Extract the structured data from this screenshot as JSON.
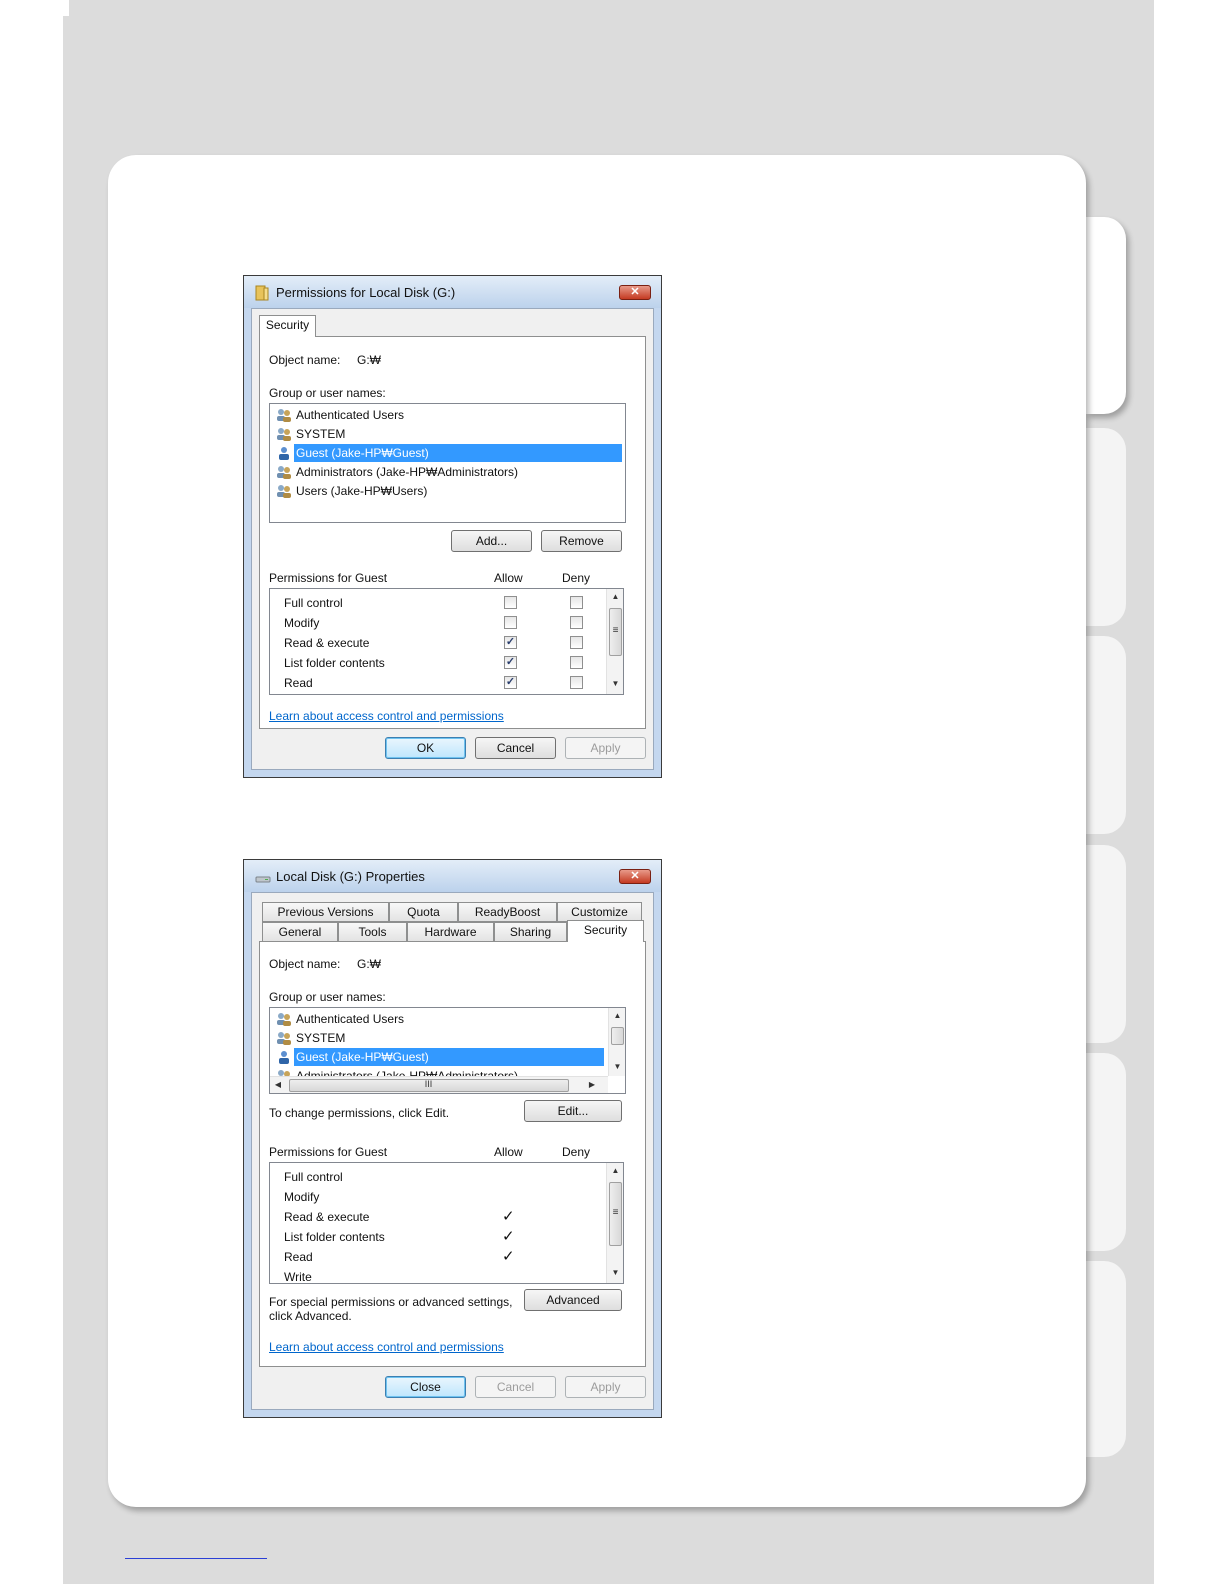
{
  "perm_window": {
    "title": "Permissions for Local Disk (G:)",
    "close_glyph": "✕",
    "tab": "Security",
    "object_label": "Object name:",
    "object_value": "G:₩",
    "group_label": "Group or user names:",
    "users": [
      {
        "name": "Authenticated Users",
        "icon": "users-group-icon",
        "selected": false
      },
      {
        "name": "SYSTEM",
        "icon": "users-group-icon",
        "selected": false
      },
      {
        "name": "Guest (Jake-HP₩Guest)",
        "icon": "user-icon",
        "selected": true
      },
      {
        "name": "Administrators (Jake-HP₩Administrators)",
        "icon": "users-group-icon",
        "selected": false
      },
      {
        "name": "Users (Jake-HP₩Users)",
        "icon": "users-group-icon",
        "selected": false
      }
    ],
    "add_button": "Add...",
    "remove_button": "Remove",
    "permissions_header": "Permissions for Guest",
    "allow_header": "Allow",
    "deny_header": "Deny",
    "permissions": [
      {
        "name": "Full control",
        "allow": false,
        "deny": false
      },
      {
        "name": "Modify",
        "allow": false,
        "deny": false
      },
      {
        "name": "Read & execute",
        "allow": true,
        "deny": false
      },
      {
        "name": "List folder contents",
        "allow": true,
        "deny": false
      },
      {
        "name": "Read",
        "allow": true,
        "deny": false
      }
    ],
    "learn_link": "Learn about access control and permissions",
    "ok_button": "OK",
    "cancel_button": "Cancel",
    "apply_button": "Apply"
  },
  "props_window": {
    "title": "Local Disk (G:) Properties",
    "close_glyph": "✕",
    "tabs_top": [
      "Previous Versions",
      "Quota",
      "ReadyBoost",
      "Customize"
    ],
    "tabs_bottom": [
      "General",
      "Tools",
      "Hardware",
      "Sharing",
      "Security"
    ],
    "selected_tab": "Security",
    "object_label": "Object name:",
    "object_value": "G:₩",
    "group_label": "Group or user names:",
    "users": [
      {
        "name": "Authenticated Users",
        "icon": "users-group-icon",
        "selected": false
      },
      {
        "name": "SYSTEM",
        "icon": "users-group-icon",
        "selected": false
      },
      {
        "name": "Guest (Jake-HP₩Guest)",
        "icon": "user-icon",
        "selected": true
      },
      {
        "name": "Administrators (Jake-HP₩Administrators)",
        "icon": "users-group-icon",
        "selected": false
      }
    ],
    "hscroll_grip": "III",
    "change_text": "To change permissions, click Edit.",
    "edit_button": "Edit...",
    "permissions_header": "Permissions for Guest",
    "allow_header": "Allow",
    "deny_header": "Deny",
    "permissions": [
      {
        "name": "Full control",
        "allow": false,
        "deny": false
      },
      {
        "name": "Modify",
        "allow": false,
        "deny": false
      },
      {
        "name": "Read & execute",
        "allow": true,
        "deny": false
      },
      {
        "name": "List folder contents",
        "allow": true,
        "deny": false
      },
      {
        "name": "Read",
        "allow": true,
        "deny": false
      },
      {
        "name": "Write",
        "allow": false,
        "deny": false
      }
    ],
    "tick_glyph": "✓",
    "special_text_line1": "For special permissions or advanced settings,",
    "special_text_line2": "click Advanced.",
    "advanced_button": "Advanced",
    "learn_link": "Learn about access control and permissions",
    "close_button": "Close",
    "cancel_button": "Cancel",
    "apply_button": "Apply"
  },
  "scroll_glyphs": {
    "up": "▲",
    "down": "▼",
    "left": "◀",
    "right": "▶",
    "grip": "≡"
  },
  "colors": {
    "selection": "#3399ff",
    "link": "#0066cc",
    "close_red": "#c43a22"
  }
}
